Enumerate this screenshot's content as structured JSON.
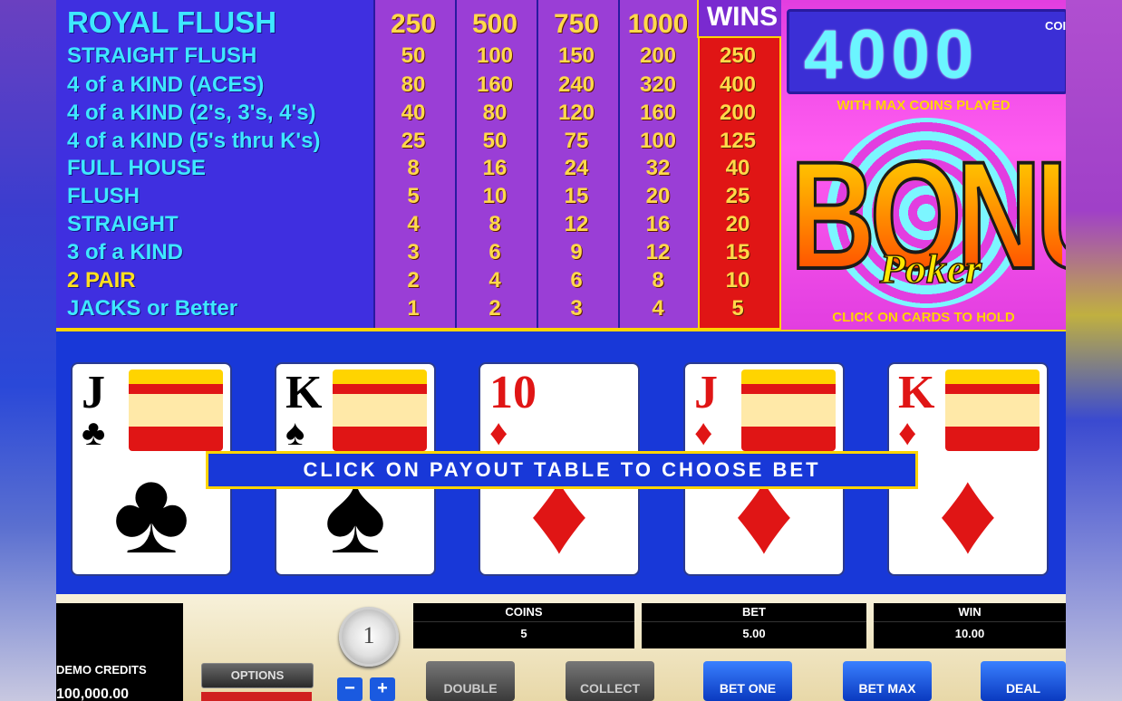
{
  "paytable": {
    "hands": [
      {
        "name": "ROYAL FLUSH",
        "pays": [
          "250",
          "500",
          "750",
          "1000"
        ],
        "win": "WINS"
      },
      {
        "name": "STRAIGHT FLUSH",
        "pays": [
          "50",
          "100",
          "150",
          "200"
        ],
        "win": "250"
      },
      {
        "name": "4 of a KIND (ACES)",
        "pays": [
          "80",
          "160",
          "240",
          "320"
        ],
        "win": "400"
      },
      {
        "name": "4 of a KIND (2's, 3's, 4's)",
        "pays": [
          "40",
          "80",
          "120",
          "160"
        ],
        "win": "200"
      },
      {
        "name": "4 of a KIND (5's thru K's)",
        "pays": [
          "25",
          "50",
          "75",
          "100"
        ],
        "win": "125"
      },
      {
        "name": "FULL HOUSE",
        "pays": [
          "8",
          "16",
          "24",
          "32"
        ],
        "win": "40"
      },
      {
        "name": "FLUSH",
        "pays": [
          "5",
          "10",
          "15",
          "20"
        ],
        "win": "25"
      },
      {
        "name": "STRAIGHT",
        "pays": [
          "4",
          "8",
          "12",
          "16"
        ],
        "win": "20"
      },
      {
        "name": "3 of a KIND",
        "pays": [
          "3",
          "6",
          "9",
          "12"
        ],
        "win": "15"
      },
      {
        "name": "2 PAIR",
        "pays": [
          "2",
          "4",
          "6",
          "8"
        ],
        "win": "10"
      },
      {
        "name": "JACKS or Better",
        "pays": [
          "1",
          "2",
          "3",
          "4"
        ],
        "win": "5"
      }
    ],
    "highlight_color": "#ffe020",
    "selected_color": "#e01515"
  },
  "bonus": {
    "jackpot": "4000",
    "coins_label": "COINS",
    "with_max": "WITH MAX COINS PLAYED",
    "logo_bonus": "BONUS",
    "logo_poker": "Poker",
    "hold_msg": "CLICK ON CARDS TO HOLD"
  },
  "cards": [
    {
      "rank": "J",
      "suit": "♣",
      "color": "black",
      "face": true
    },
    {
      "rank": "K",
      "suit": "♠",
      "color": "black",
      "face": true
    },
    {
      "rank": "10",
      "suit": "♦",
      "color": "red",
      "face": false
    },
    {
      "rank": "J",
      "suit": "♦",
      "color": "red",
      "face": true
    },
    {
      "rank": "K",
      "suit": "♦",
      "color": "red",
      "face": true
    }
  ],
  "message": "CLICK ON PAYOUT TABLE TO CHOOSE BET",
  "controls": {
    "credits_label": "DEMO CREDITS",
    "credits_value": "100,000.00",
    "options": "OPTIONS",
    "coin_value": "1",
    "minus": "−",
    "plus": "+",
    "coins_label": "COINS",
    "coins_value": "5",
    "bet_label": "BET",
    "bet_value": "5.00",
    "win_label": "WIN",
    "win_value": "10.00",
    "double": "DOUBLE",
    "collect": "COLLECT",
    "bet_one": "BET ONE",
    "bet_max": "BET MAX",
    "deal": "DEAL"
  }
}
